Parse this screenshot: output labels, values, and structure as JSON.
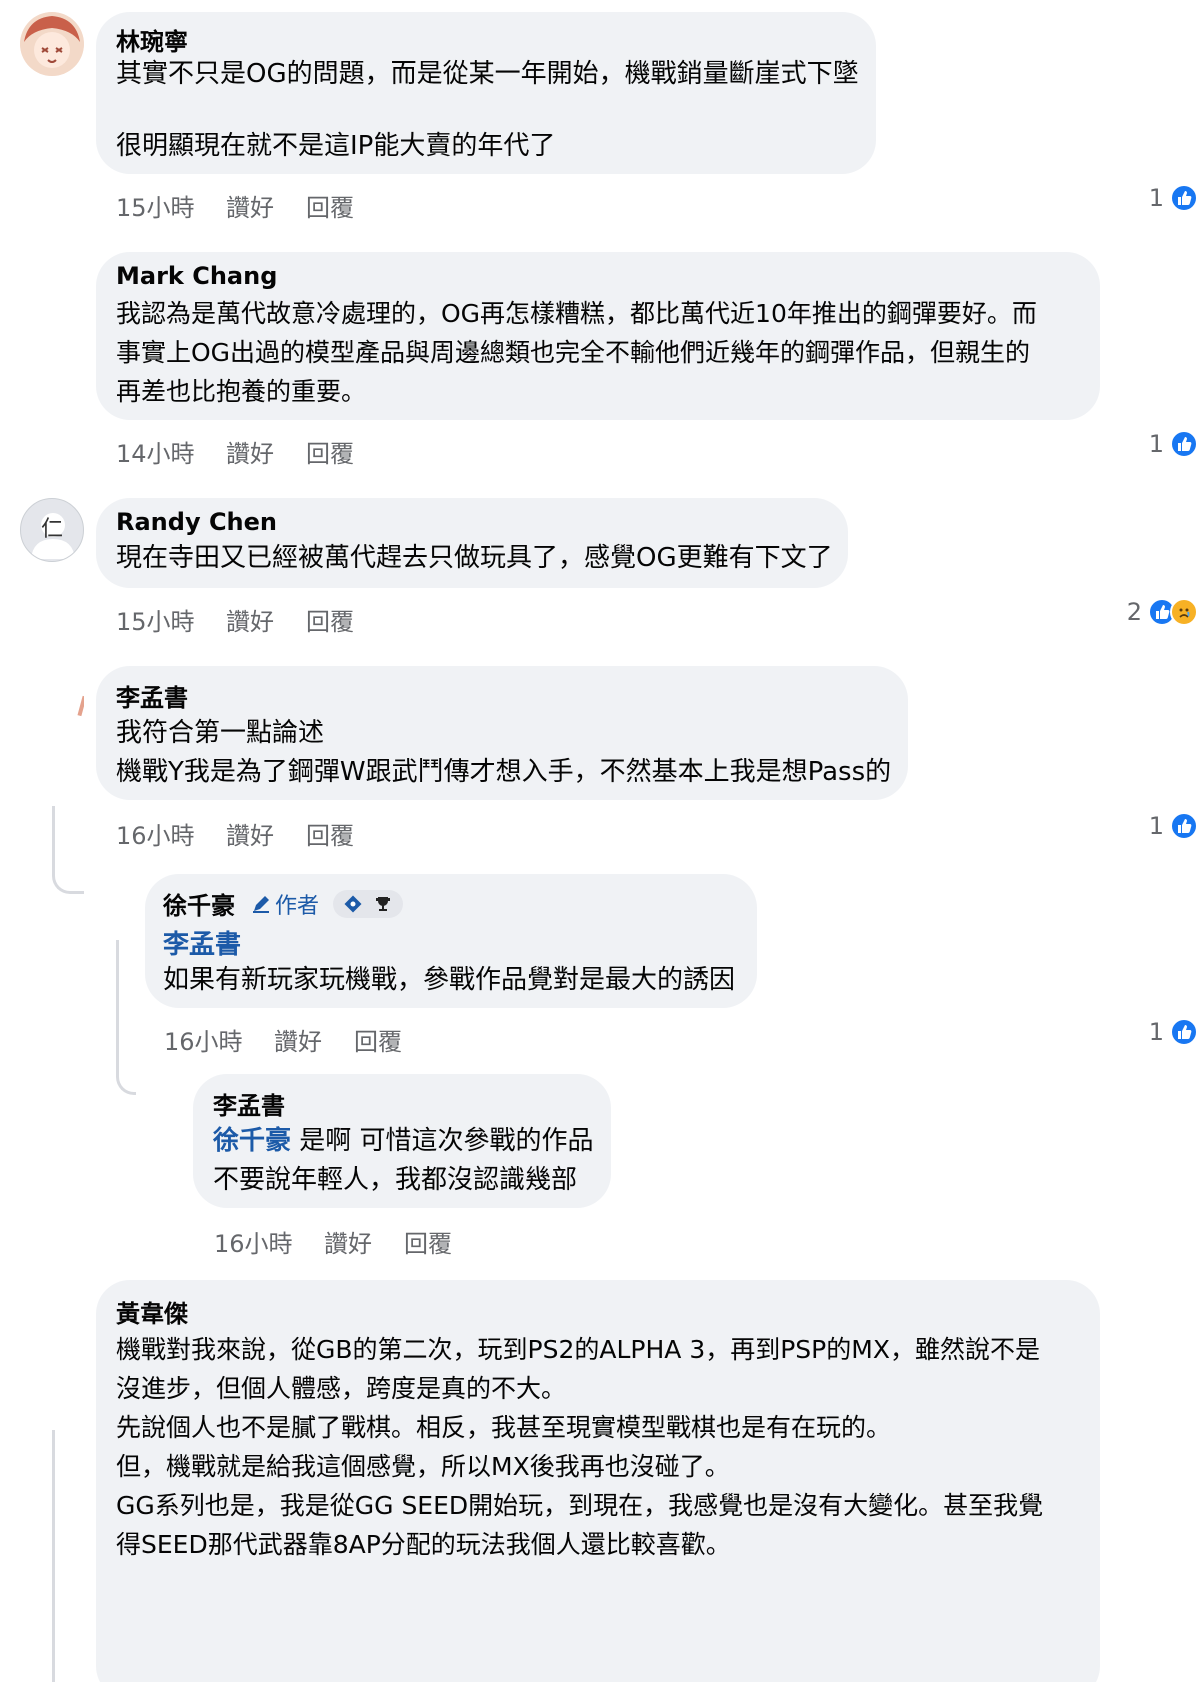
{
  "colors": {
    "bubble_bg": "#f0f2f5",
    "meta_text": "#65676b",
    "mention": "#1c5aa8",
    "like_blue": "#1877f2"
  },
  "actions": {
    "like": "讚好",
    "reply": "回覆"
  },
  "comments": [
    {
      "author": "林琬寧",
      "text": "其實不只是OG的問題，而是從某一年開始，機戰銷量斷崖式下墜\n\n很明顯現在就不是這IP能大賣的年代了",
      "time": "15小時",
      "reactions": "1"
    },
    {
      "author": "Mark Chang",
      "text": "我認為是萬代故意冷處理的，OG再怎樣糟糕，都比萬代近10年推出的鋼彈要好。而\n事實上OG出過的模型產品與周邊總類也完全不輸他們近幾年的鋼彈作品，但親生的\n再差也比抱養的重要。",
      "time": "14小時",
      "reactions": "1"
    },
    {
      "author": "Randy Chen",
      "text": "現在寺田又已經被萬代趕去只做玩具了，感覺OG更難有下文了",
      "time": "15小時",
      "reactions": "2",
      "avatar_initial": "仁"
    },
    {
      "author": "李孟書",
      "text": "我符合第一點論述\n機戰Y我是為了鋼彈W跟武鬥傳才想入手，不然基本上我是想Pass的",
      "time": "16小時",
      "reactions": "1"
    },
    {
      "author": "徐千豪",
      "author_badge": "作者",
      "mention": "李孟書",
      "text": "如果有新玩家玩機戰，參戰作品覺對是最大的誘因",
      "time": "16小時",
      "reactions": "1"
    },
    {
      "author": "李孟書",
      "mention": "徐千豪",
      "text_first": " 是啊 可惜這次參戰的作品",
      "text_rest": "不要說年輕人，我都沒認識幾部",
      "time": "16小時"
    },
    {
      "author": "黃韋傑",
      "text": "機戰對我來說，從GB的第二次，玩到PS2的ALPHA 3，再到PSP的MX，雖然說不是\n沒進步，但個人體感，跨度是真的不大。\n先說個人也不是膩了戰棋。相反，我甚至現實模型戰棋也是有在玩的。\n但，機戰就是給我這個感覺，所以MX後我再也沒碰了。\nGG系列也是，我是從GG SEED開始玩，到現在，我感覺也是沒有大變化。甚至我覺\n得SEED那代武器靠8AP分配的玩法我個人還比較喜歡。"
    }
  ]
}
